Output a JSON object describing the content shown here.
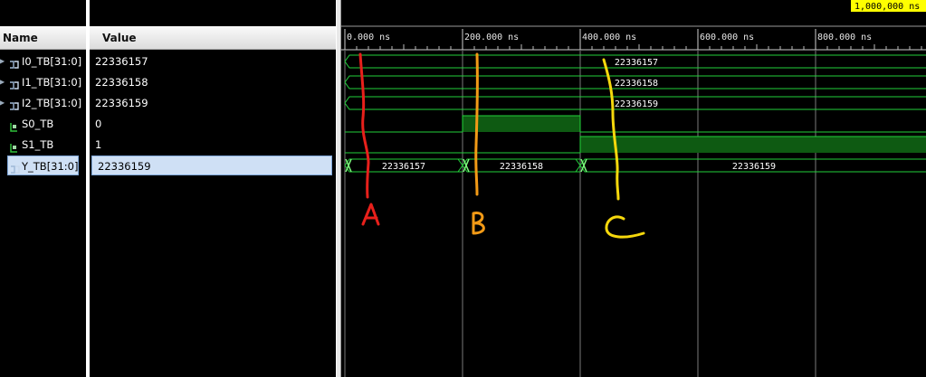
{
  "headers": {
    "name": "Name",
    "value": "Value"
  },
  "signals": [
    {
      "name": "I0_TB[31:0]",
      "value": "22336157",
      "kind": "bus",
      "icon": "bus-icon",
      "expandable": true
    },
    {
      "name": "I1_TB[31:0]",
      "value": "22336158",
      "kind": "bus",
      "icon": "bus-icon",
      "expandable": true
    },
    {
      "name": "I2_TB[31:0]",
      "value": "22336159",
      "kind": "bus",
      "icon": "bus-icon",
      "expandable": true
    },
    {
      "name": "S0_TB",
      "value": "0",
      "kind": "bit",
      "icon": "bit-signal-icon",
      "expandable": false
    },
    {
      "name": "S1_TB",
      "value": "1",
      "kind": "bit",
      "icon": "bit-signal-icon",
      "expandable": false
    },
    {
      "name": "Y_TB[31:0]",
      "value": "22336159",
      "kind": "bus",
      "icon": "bus-icon",
      "expandable": true,
      "selected": true
    }
  ],
  "timeline": {
    "end_marker": "1,000,000 ns",
    "ticks": [
      "0.000 ns",
      "200.000 ns",
      "400.000 ns",
      "600.000 ns",
      "800.000 ns"
    ],
    "ns_per_major": 200
  },
  "waveforms": {
    "I0_TB[31:0]": [
      {
        "t0": 0,
        "t1": 1000,
        "label": "22336157"
      }
    ],
    "I1_TB[31:0]": [
      {
        "t0": 0,
        "t1": 1000,
        "label": "22336158"
      }
    ],
    "I2_TB[31:0]": [
      {
        "t0": 0,
        "t1": 1000,
        "label": "22336159"
      }
    ],
    "S0_TB": [
      {
        "t0": 0,
        "t1": 200,
        "v": 0
      },
      {
        "t0": 200,
        "t1": 400,
        "v": 1
      },
      {
        "t0": 400,
        "t1": 1000,
        "v": 0
      }
    ],
    "S1_TB": [
      {
        "t0": 0,
        "t1": 400,
        "v": 0
      },
      {
        "t0": 400,
        "t1": 1000,
        "v": 1
      }
    ],
    "Y_TB[31:0]": [
      {
        "t0": 0,
        "t1": 200,
        "label": "22336157"
      },
      {
        "t0": 200,
        "t1": 400,
        "label": "22336158"
      },
      {
        "t0": 400,
        "t1": 1000,
        "label": "22336159"
      }
    ]
  },
  "annotations": [
    {
      "label": "A",
      "color": "#e8201b"
    },
    {
      "label": "B",
      "color": "#f29a16"
    },
    {
      "label": "C",
      "color": "#f6d80c"
    }
  ],
  "colors": {
    "trace": "#22d13a",
    "high_fill": "#0e5a12",
    "grid": "#7a7a7a",
    "marker_bg": "#ffff00"
  }
}
